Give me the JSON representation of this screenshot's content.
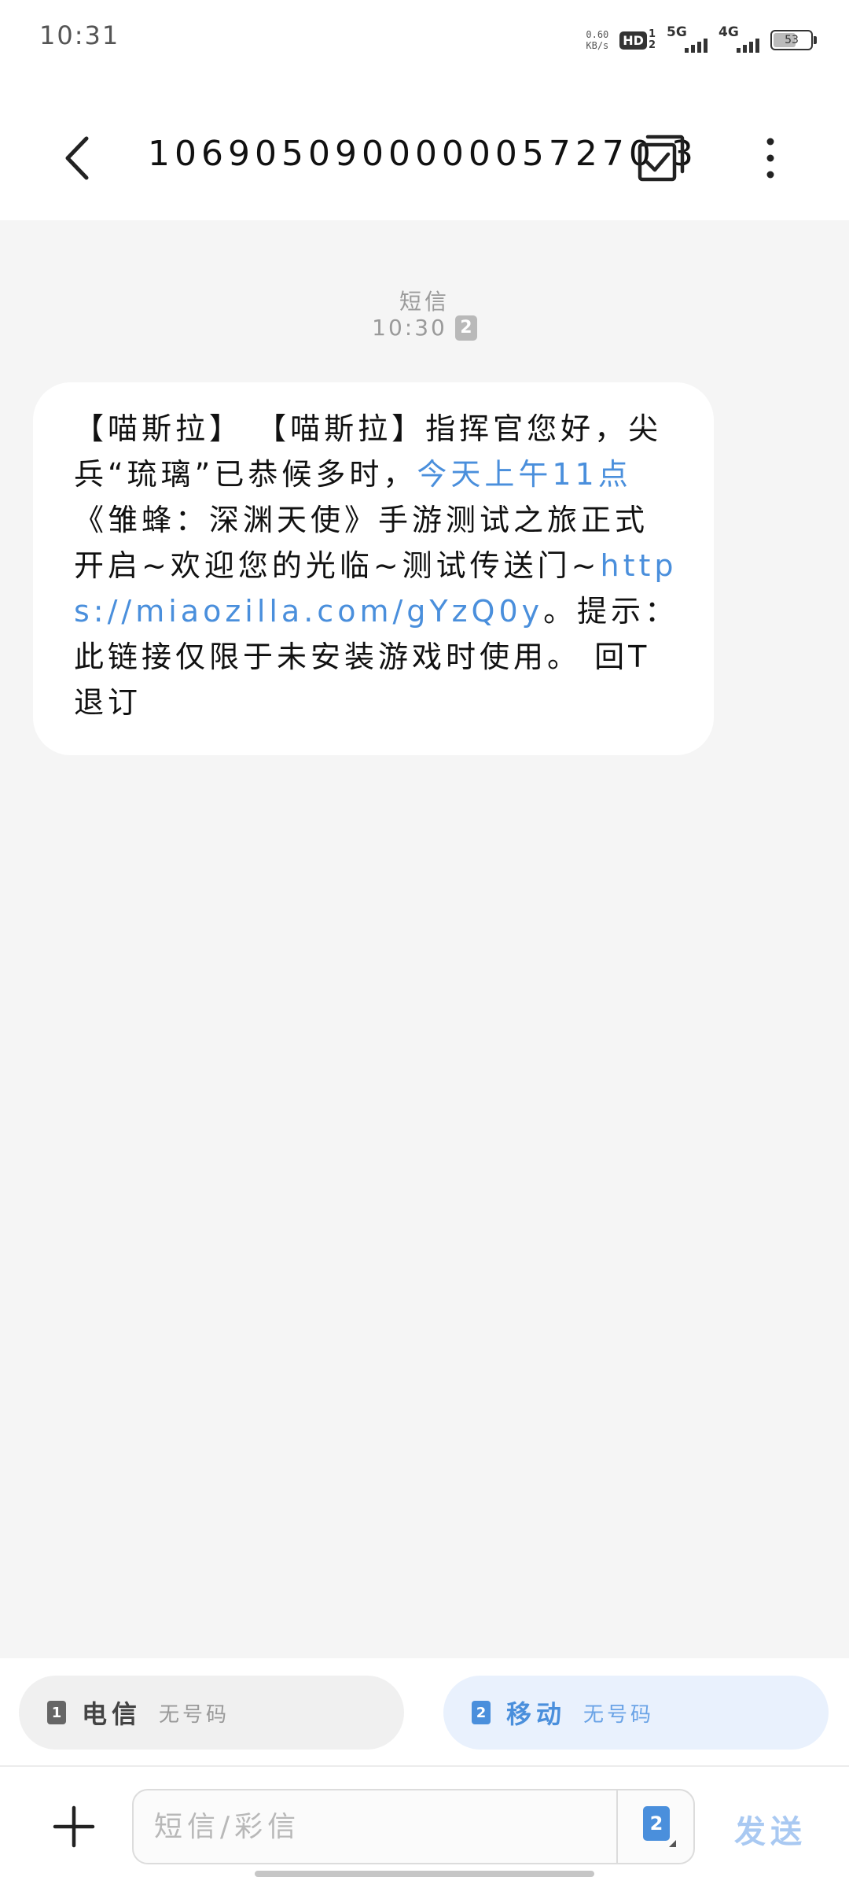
{
  "status_bar": {
    "time": "10:31",
    "net_speed_value": "0.60",
    "net_speed_unit": "KB/s",
    "hd_label": "HD",
    "hd_sim1": "1",
    "hd_sim2": "2",
    "sim1_network": "5G",
    "sim2_network": "4G",
    "battery_level": "53"
  },
  "header": {
    "title": "1069050900000057270 3",
    "back_icon": "chevron-left-icon",
    "select_icon": "multi-select-check-icon",
    "more_icon": "more-vertical-icon"
  },
  "conversation": {
    "channel_label": "短信",
    "message_time": "10:30",
    "message_sim": "2",
    "message": {
      "part1": "【喵斯拉】 【喵斯拉】指挥官您好，尖兵“琉璃”已恭候多时，",
      "link_time": "今天上午11点",
      "part2": "《雏蜂：深渊天使》手游测试之旅正式开启~欢迎您的光临~测试传送门~",
      "link_url": "https://miaozilla.com/gYzQ0y",
      "part3": "。提示：此链接仅限于未安装游戏时使用。 回T退订"
    }
  },
  "sim_selector": {
    "sim1": {
      "index": "1",
      "name": "电信",
      "number": "无号码"
    },
    "sim2": {
      "index": "2",
      "name": "移动",
      "number": "无号码"
    }
  },
  "composer": {
    "add_icon": "plus-icon",
    "placeholder": "短信/彩信",
    "sim_switch": "2",
    "send_label": "发送"
  },
  "colors": {
    "accent": "#4a8fdc",
    "send_disabled": "#a9c9f2",
    "conversation_bg": "#f5f5f5",
    "bubble_bg": "#ffffff"
  }
}
